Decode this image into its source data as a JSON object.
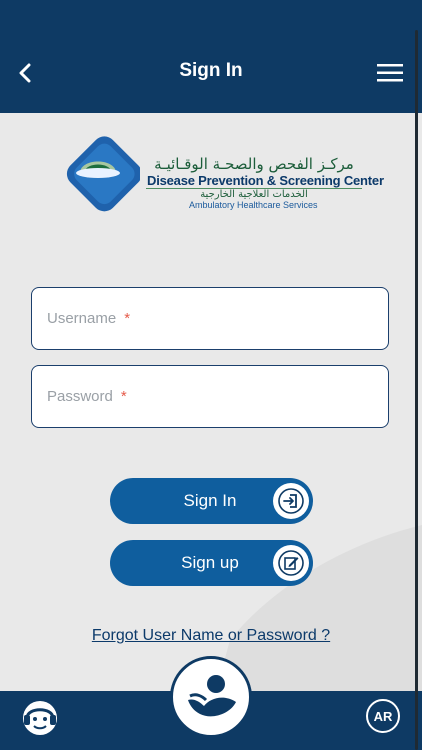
{
  "header": {
    "title": "Sign In",
    "back_icon": "chevron-left-icon",
    "menu_icon": "hamburger-menu-icon"
  },
  "logo": {
    "arabic_name": "مركـز الفحص والصحـة الوقـائيـة",
    "english_name": "Disease Prevention & Screening Center",
    "arabic_sub": "الخدمات العلاجية الخارجية",
    "english_sub": "Ambulatory Healthcare Services"
  },
  "form": {
    "username": {
      "placeholder": "Username",
      "required_mark": "*",
      "value": ""
    },
    "password": {
      "placeholder": "Password",
      "required_mark": "*",
      "value": ""
    }
  },
  "buttons": {
    "signin": {
      "label": "Sign In",
      "icon": "login-icon"
    },
    "signup": {
      "label": "Sign up",
      "icon": "edit-icon"
    }
  },
  "forgot_link": "Forgot User Name or Password ?",
  "footer": {
    "support_icon": "support-headset-icon",
    "home_icon": "home-logo-icon",
    "language_label": "AR"
  },
  "colors": {
    "primary_dark": "#0e3a64",
    "button_blue": "#0f5e9e",
    "required_red": "#e55b4a",
    "background": "#e9e9e9"
  }
}
